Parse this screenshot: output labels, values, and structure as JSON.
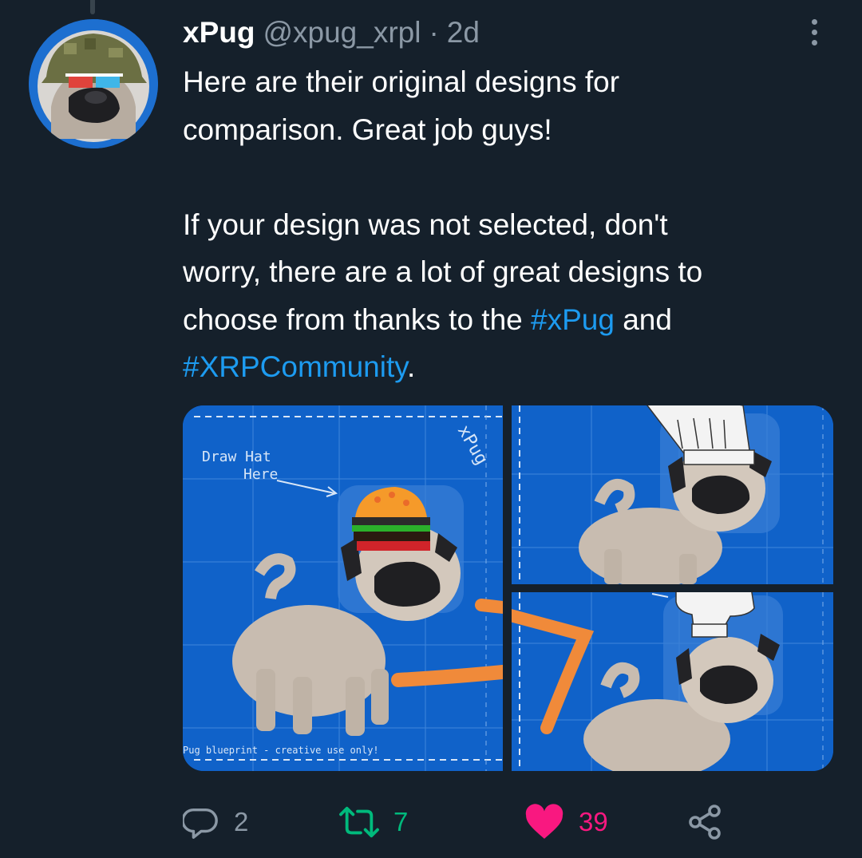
{
  "tweet": {
    "display_name": "xPug",
    "handle": "@xpug_xrpl",
    "separator": "·",
    "time": "2d",
    "text": {
      "line1": "Here are their original designs for",
      "line2": "comparison. Great job guys!",
      "line3": "If your design was not selected, don't",
      "line4": "worry, there are a lot of great designs to",
      "line5_prefix": "choose from thanks to the ",
      "hashtag1": "#xPug",
      "line5_suffix": " and",
      "hashtag2": "#XRPCommunity",
      "line6_suffix": "."
    }
  },
  "media": {
    "image1": {
      "label_draw": "Draw Hat",
      "label_here": "Here",
      "watermark": "xPug",
      "footer": "Pug blueprint - creative use only!"
    }
  },
  "actions": {
    "reply_count": "2",
    "retweet_count": "7",
    "like_count": "39"
  },
  "icons": {
    "more": "more-vertical-icon",
    "reply": "speech-bubble-icon",
    "retweet": "retweet-icon",
    "like": "heart-filled-icon",
    "share": "share-icon"
  },
  "colors": {
    "background": "#15202b",
    "text_primary": "#ffffff",
    "text_secondary": "#8b98a5",
    "link": "#1d9bf0",
    "retweet_green": "#00ba7c",
    "like_pink": "#f91880",
    "blueprint_blue": "#1062c9"
  }
}
